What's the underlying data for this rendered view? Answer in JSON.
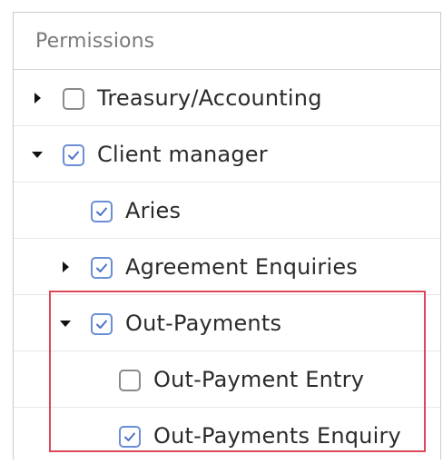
{
  "panel": {
    "title": "Permissions"
  },
  "tree": {
    "items": [
      {
        "label": "Treasury/Accounting",
        "checked": false,
        "toggle": "collapsed"
      },
      {
        "label": "Client manager",
        "checked": true,
        "toggle": "expanded"
      },
      {
        "label": "Aries",
        "checked": true,
        "toggle": "none"
      },
      {
        "label": "Agreement Enquiries",
        "checked": true,
        "toggle": "collapsed"
      },
      {
        "label": "Out-Payments",
        "checked": true,
        "toggle": "expanded"
      },
      {
        "label": "Out-Payment Entry",
        "checked": false,
        "toggle": "none"
      },
      {
        "label": "Out-Payments Enquiry",
        "checked": true,
        "toggle": "none"
      }
    ]
  },
  "colors": {
    "checkbox_checked": "#6b8fd6",
    "highlight_border": "#e0465a"
  }
}
